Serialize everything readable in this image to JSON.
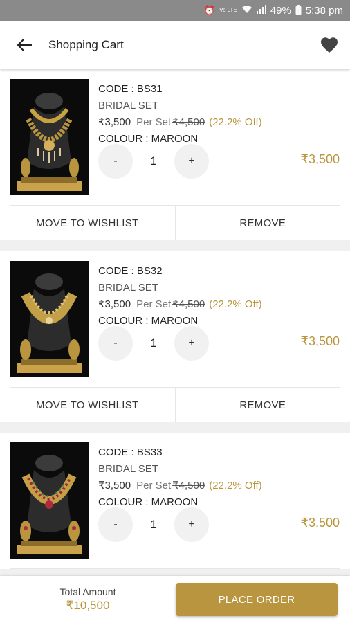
{
  "status_bar": {
    "battery": "49%",
    "time": "5:38 pm",
    "network": "Vo LTE"
  },
  "header": {
    "title": "Shopping Cart"
  },
  "items": [
    {
      "code": "CODE : BS31",
      "category": "BRIDAL SET",
      "price": "₹3,500",
      "per_set": "Per Set",
      "original_price": "₹4,500",
      "discount": "(22.2% Off)",
      "colour": "COLOUR : MAROON",
      "qty_minus": "-",
      "quantity": "1",
      "qty_plus": "+",
      "line_total": "₹3,500",
      "wishlist_label": "MOVE TO WISHLIST",
      "remove_label": "REMOVE"
    },
    {
      "code": "CODE : BS32",
      "category": "BRIDAL SET",
      "price": "₹3,500",
      "per_set": "Per Set",
      "original_price": "₹4,500",
      "discount": "(22.2% Off)",
      "colour": "COLOUR : MAROON",
      "qty_minus": "-",
      "quantity": "1",
      "qty_plus": "+",
      "line_total": "₹3,500",
      "wishlist_label": "MOVE TO WISHLIST",
      "remove_label": "REMOVE"
    },
    {
      "code": "CODE : BS33",
      "category": "BRIDAL SET",
      "price": "₹3,500",
      "per_set": "Per Set",
      "original_price": "₹4,500",
      "discount": "(22.2% Off)",
      "colour": "COLOUR : MAROON",
      "qty_minus": "-",
      "quantity": "1",
      "qty_plus": "+",
      "line_total": "₹3,500"
    }
  ],
  "footer": {
    "total_label": "Total Amount",
    "total_value": "₹10,500",
    "place_order_label": "PLACE ORDER"
  },
  "colors": {
    "accent": "#b8953e",
    "status_bar": "#8a8a8a"
  }
}
